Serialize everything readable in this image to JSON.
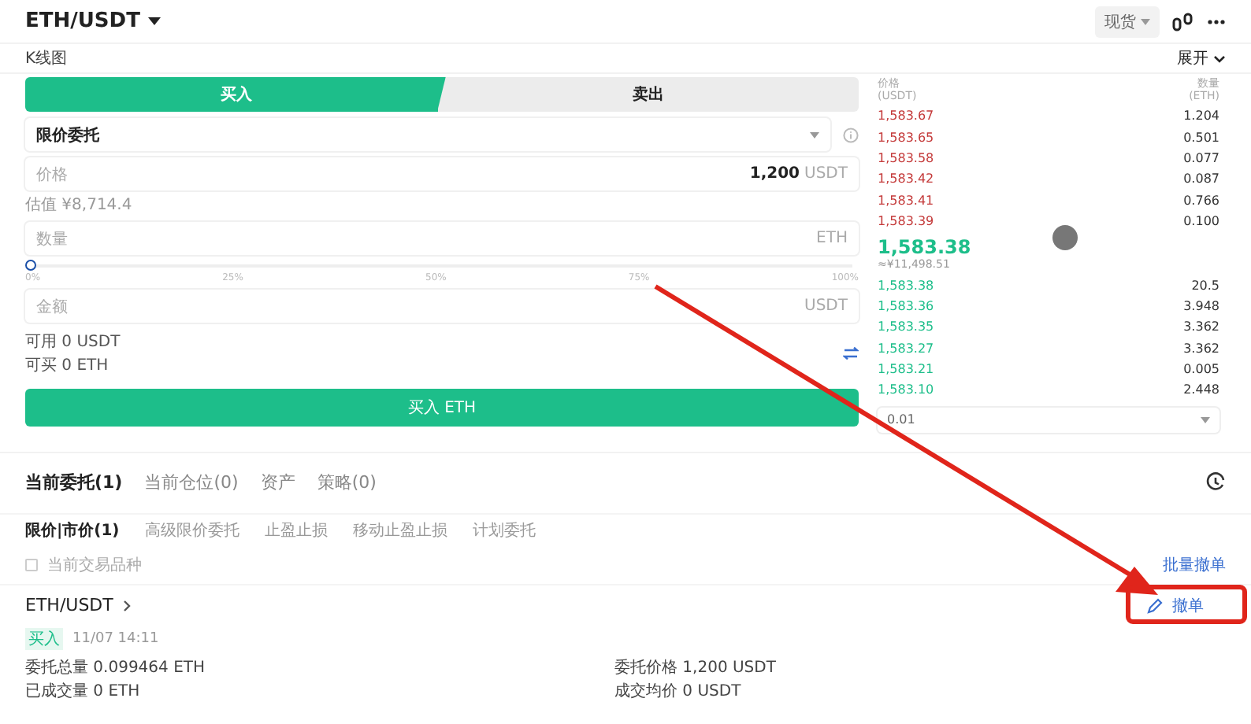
{
  "header": {
    "pair": "ETH/USDT",
    "market": "现货"
  },
  "chart_bar": {
    "label": "K线图",
    "expand": "展开"
  },
  "side_tabs": [
    {
      "label": "买入",
      "selected": true
    },
    {
      "label": "卖出",
      "selected": false
    }
  ],
  "order_type": "限价委托",
  "price_field": {
    "placeholder": "价格",
    "value": "1,200",
    "unit": "USDT"
  },
  "estimate": "估值 ¥8,714.4",
  "quantity_field": {
    "placeholder": "数量",
    "unit": "ETH"
  },
  "slider": {
    "level": 0,
    "marks": [
      "0%",
      "25%",
      "50%",
      "75%",
      "100%"
    ]
  },
  "amount_field": {
    "placeholder": "金额",
    "unit": "USDT"
  },
  "available": "可用 0 USDT",
  "can_buy": "可买 0 ETH",
  "submit": "买入 ETH",
  "order_book": {
    "price_label": "价格",
    "price_unit": "(USDT)",
    "qty_label": "数量",
    "qty_unit": "(ETH)",
    "asks": [
      {
        "price": "1,583.67",
        "qty": "1.204"
      },
      {
        "price": "1,583.65",
        "qty": "0.501"
      },
      {
        "price": "1,583.58",
        "qty": "0.077"
      },
      {
        "price": "1,583.42",
        "qty": "0.087"
      },
      {
        "price": "1,583.41",
        "qty": "0.766"
      },
      {
        "price": "1,583.39",
        "qty": "0.100"
      }
    ],
    "last_price": "1,583.38",
    "last_price_cny": "≈¥11,498.51",
    "bids": [
      {
        "price": "1,583.38",
        "qty": "20.5"
      },
      {
        "price": "1,583.36",
        "qty": "3.948"
      },
      {
        "price": "1,583.35",
        "qty": "3.362"
      },
      {
        "price": "1,583.27",
        "qty": "3.362"
      },
      {
        "price": "1,583.21",
        "qty": "0.005"
      },
      {
        "price": "1,583.10",
        "qty": "2.448"
      }
    ],
    "depth": "0.01"
  },
  "order_tabs": [
    {
      "label": "当前委托(1)",
      "selected": true
    },
    {
      "label": "当前仓位(0)",
      "selected": false
    },
    {
      "label": "资产",
      "selected": false
    },
    {
      "label": "策略(0)",
      "selected": false
    }
  ],
  "order_subtabs": [
    {
      "label": "限价|市价(1)",
      "selected": true
    },
    {
      "label": "高级限价委托",
      "selected": false
    },
    {
      "label": "止盈止损",
      "selected": false
    },
    {
      "label": "移动止盈止损",
      "selected": false
    },
    {
      "label": "计划委托",
      "selected": false
    }
  ],
  "filter": {
    "label": "当前交易品种",
    "checked": false
  },
  "cancel_all": "批量撤单",
  "order": {
    "pair": "ETH/USDT",
    "side": "买入",
    "time": "11/07 14:11",
    "cancel": "撤单",
    "fields": [
      {
        "label": "委托总量",
        "value": "0.099464 ETH"
      },
      {
        "label": "委托价格",
        "value": "1,200 USDT"
      },
      {
        "label": "已成交量",
        "value": "0 ETH"
      },
      {
        "label": "成交均价",
        "value": "0 USDT"
      }
    ]
  }
}
